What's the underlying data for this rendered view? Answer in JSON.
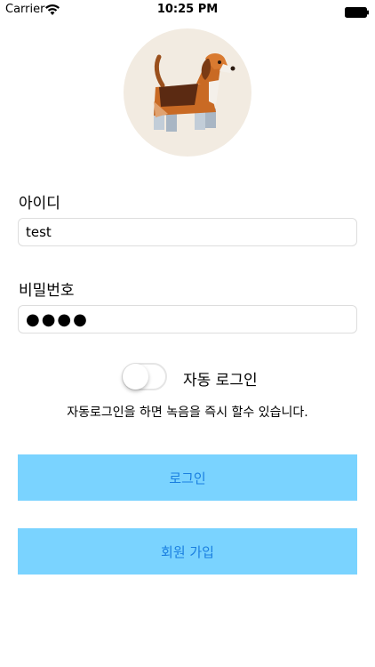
{
  "status_bar": {
    "carrier": "Carrier",
    "time": "10:25 PM",
    "wifi_icon": "wifi-icon",
    "battery_icon": "battery-icon"
  },
  "avatar": {
    "icon": "beagle-dog-icon"
  },
  "form": {
    "id_label": "아이디",
    "id_value": "test",
    "password_label": "비밀번호",
    "password_value": "●●●●"
  },
  "auto_login": {
    "label": "자동 로그인",
    "enabled": false,
    "hint": "자동로그인을 하면 녹음을 즉시 할수 있습니다."
  },
  "buttons": {
    "login_label": "로그인",
    "signup_label": "회원 가입"
  },
  "colors": {
    "button_bg": "#7ad3ff",
    "button_text": "#1a7fe0",
    "avatar_bg": "#f2ebe1"
  }
}
